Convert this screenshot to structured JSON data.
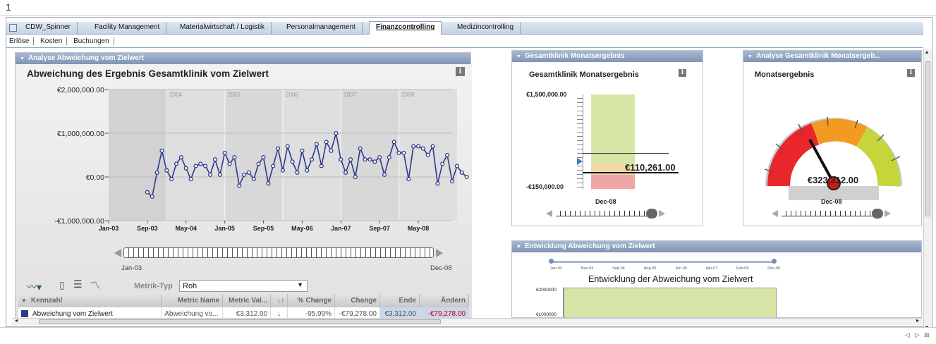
{
  "window": {
    "title": "1"
  },
  "tabs": [
    "CDW_Spinner",
    "Facility Management",
    "Materialwirtschaft / Logistik",
    "Personalmanagement",
    "Finanzcontrolling",
    "Medizincontrolling"
  ],
  "active_tab": "Finanzcontrolling",
  "subnav": [
    "Erlöse",
    "Kosten",
    "Buchungen"
  ],
  "left_panel": {
    "header": "Analyse Abweichung vom Zielwert",
    "title": "Abweichung des Ergebnis Gesamtklinik vom Zielwert",
    "info": "i",
    "slider_start": "Jan-03",
    "slider_end": "Dec-08",
    "metric_type_label": "Metrik-Typ",
    "metric_type_value": "Roh",
    "table": {
      "headers": [
        "Kennzahl",
        "Metric Name",
        "Metric Val...",
        "↓↑",
        "% Change",
        "Change",
        "Ende",
        "Ändern"
      ],
      "row": {
        "kennzahl": "Abweichung vom Zielwert",
        "metric_name": "Abweichung vo...",
        "metric_value": "€3,312.00",
        "pct_change": "-95.99%",
        "change": "-€79,278.00",
        "ende": "€3,312.00",
        "andern": "-€79,278.00"
      }
    }
  },
  "chart_data": {
    "type": "line",
    "title": "Abweichung des Ergebnis Gesamtklinik vom Zielwert",
    "x_tick_labels": [
      "Jan-03",
      "Sep-03",
      "May-04",
      "Jan-05",
      "Sep-05",
      "May-06",
      "Jan-07",
      "Sep-07",
      "May-08"
    ],
    "year_bands": [
      "2004",
      "2005",
      "2006",
      "2007",
      "2008"
    ],
    "y_tick_labels": [
      "€2,000,000.00",
      "€1,000,000.00",
      "€0.00",
      "-€1,000,000.00"
    ],
    "ylim": [
      -1000000,
      2000000
    ],
    "grid": true,
    "x_start": "Jan-03",
    "x_end": "Dec-08",
    "series": [
      {
        "x_start": "Sep-03",
        "values": [
          -350000,
          -450000,
          100000,
          600000,
          150000,
          -50000,
          300000,
          450000,
          200000,
          -50000,
          250000,
          300000,
          250000,
          50000,
          400000,
          50000,
          550000,
          300000,
          450000,
          -200000,
          50000,
          100000,
          -50000,
          300000,
          450000,
          -150000,
          250000,
          650000,
          150000,
          700000,
          350000,
          100000,
          600000,
          150000,
          400000,
          750000,
          250000,
          800000,
          600000,
          1000000,
          400000,
          100000,
          400000,
          0,
          650000,
          400000,
          400000,
          350000,
          450000,
          50000,
          450000,
          800000,
          550000,
          550000,
          -50000,
          700000,
          700000,
          650000,
          500000,
          700000,
          -150000,
          300000,
          500000,
          -100000,
          250000,
          100000,
          0
        ]
      }
    ]
  },
  "monthly_panel": {
    "header": "Gesamtklinik Monatsergebnis",
    "title": "Gesamtklinik Monatsergebnis",
    "info": "i",
    "top_label": "€1,500,000.00",
    "bottom_label": "-€150,000.00",
    "value": "€110,261.00",
    "period": "Dec-08"
  },
  "gauge_panel": {
    "header": "Analyse Gesamtklinik Monatsergeb...",
    "title": "Monatsergebnis",
    "info": "i",
    "value": "€323,312.00",
    "period": "Dec-08",
    "colors": {
      "red": "#e8262b",
      "orange": "#f39a22",
      "yellow_green": "#c6d63a"
    }
  },
  "trend_panel": {
    "header": "Entwicklung Abweichung vom Zielwert",
    "title": "Entwicklung der Abweichung vom Zielwert",
    "timeline": [
      "Jan-03",
      "Nov-03",
      "Sep-04",
      "Aug-05",
      "Jun-06",
      "Apr-07",
      "Feb-08",
      "Dec-08"
    ],
    "y_labels": [
      "€2000000",
      "€1000000"
    ]
  },
  "colors": {
    "accent_blue": "#2d3a8c",
    "panel_header": "#8fa2bf",
    "red_text": "#cc0000"
  }
}
